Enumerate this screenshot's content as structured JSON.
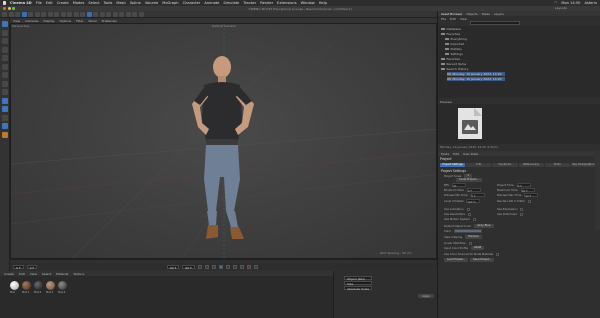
{
  "menubar": {
    "app_name": "Cinema 4D",
    "items": [
      "File",
      "Edit",
      "Create",
      "Modes",
      "Select",
      "Tools",
      "Mesh",
      "Spline",
      "Volume",
      "MoGraph",
      "Character",
      "Animate",
      "Simulate",
      "Tracker",
      "Render",
      "Extensions",
      "Window",
      "Help"
    ],
    "clock": "Mon 14:50",
    "user": "Asterix"
  },
  "window": {
    "title": "CINEMA 4D R25 Educational License - Real Commercial - [Untitled 1]",
    "layout_label": "Layouts"
  },
  "viewport": {
    "menu": [
      "View",
      "Cameras",
      "Display",
      "Options",
      "Filter",
      "Panel",
      "ProRender"
    ],
    "label": "Perspective",
    "camera": "Default Camera",
    "grid_spacing": "Grid Spacing : 50 cm"
  },
  "timeline": {
    "start_frame": "0 F",
    "current_frame": "0 F",
    "end_frame": "90 F",
    "end_frame_2": "90 F"
  },
  "material_manager": {
    "menu": [
      "Create",
      "Edit",
      "View",
      "Select",
      "Material",
      "Texture"
    ],
    "materials": [
      {
        "label": "Mat",
        "color": "#c9c9c9"
      },
      {
        "label": "Mat.1",
        "color": "#6b4a34"
      },
      {
        "label": "Mat.2",
        "color": "#3a3a3a"
      },
      {
        "label": "Mat.3",
        "color": "#8c6a55"
      },
      {
        "label": "Mat.4",
        "color": "#545454"
      }
    ]
  },
  "coordinates": {
    "options": [
      "Object (Rel)",
      "Size",
      "Absolute Scale"
    ],
    "apply": "Apply"
  },
  "right_panel": {
    "tabs": [
      "Asset Browser",
      "Objects",
      "Takes",
      "Layers"
    ],
    "asset_menu": [
      "File",
      "Edit",
      "View"
    ],
    "tree": [
      {
        "label": "Database",
        "selected": false
      },
      {
        "label": "Favorites",
        "selected": false
      },
      {
        "label": "Everything",
        "selected": false
      },
      {
        "label": "Imported",
        "selected": false
      },
      {
        "label": "Prefabs",
        "selected": false
      },
      {
        "label": "Settings",
        "selected": false
      },
      {
        "label": "Favorites",
        "selected": false
      },
      {
        "label": "Recent Items",
        "selected": false
      },
      {
        "label": "Search History",
        "selected": false
      },
      {
        "label": "Monday, 10 January 2022, 14:20",
        "selected": true
      },
      {
        "label": "Monday, 10 January 2022, 14:20",
        "selected": true
      }
    ],
    "preview_label": "Preview",
    "preview_caption": "Monday, 10 January 2022, 14:20 (1 item)"
  },
  "attributes": {
    "menu": [
      "Mode",
      "Edit",
      "User Data"
    ],
    "title": "Project",
    "tabs": [
      "Project Settings",
      "Info",
      "Dynamics",
      "Referencing",
      "To Do",
      "Key Interpolation"
    ],
    "heading": "Project Settings",
    "rows": [
      {
        "label": "Project Scale",
        "value": "1"
      },
      {
        "label": "FPS",
        "value": "30"
      },
      {
        "label": "Minimum Time",
        "value": "0 F"
      },
      {
        "label": "Preview Min Time",
        "value": "0 F"
      },
      {
        "label": "Level of Detail",
        "value": "100 %"
      },
      {
        "label": "Use Animation",
        "value": ""
      },
      {
        "label": "Use Generators",
        "value": ""
      },
      {
        "label": "Use Motion System",
        "value": ""
      },
      {
        "label": "Default Object Color",
        "value": "Gray Blue"
      },
      {
        "label": "Color",
        "value": ""
      },
      {
        "label": "View Clipping",
        "value": "Medium"
      },
      {
        "label": "Linear Workflow",
        "value": ""
      },
      {
        "label": "Input Color Profile",
        "value": "sRGB"
      },
      {
        "label": "Use Color Channel for Node Material",
        "value": ""
      }
    ],
    "rows_right": [
      {
        "label": "Project Time",
        "value": "0 F"
      },
      {
        "label": "Maximum Time",
        "value": "90 F"
      },
      {
        "label": "Preview Max Time",
        "value": "90 F"
      },
      {
        "label": "Render LOD in Editor",
        "value": ""
      },
      {
        "label": "Use Expression",
        "value": ""
      },
      {
        "label": "Use Deformers",
        "value": ""
      }
    ],
    "buttons": [
      "Scale Project...",
      "Load Preset...",
      "Save Preset..."
    ]
  }
}
